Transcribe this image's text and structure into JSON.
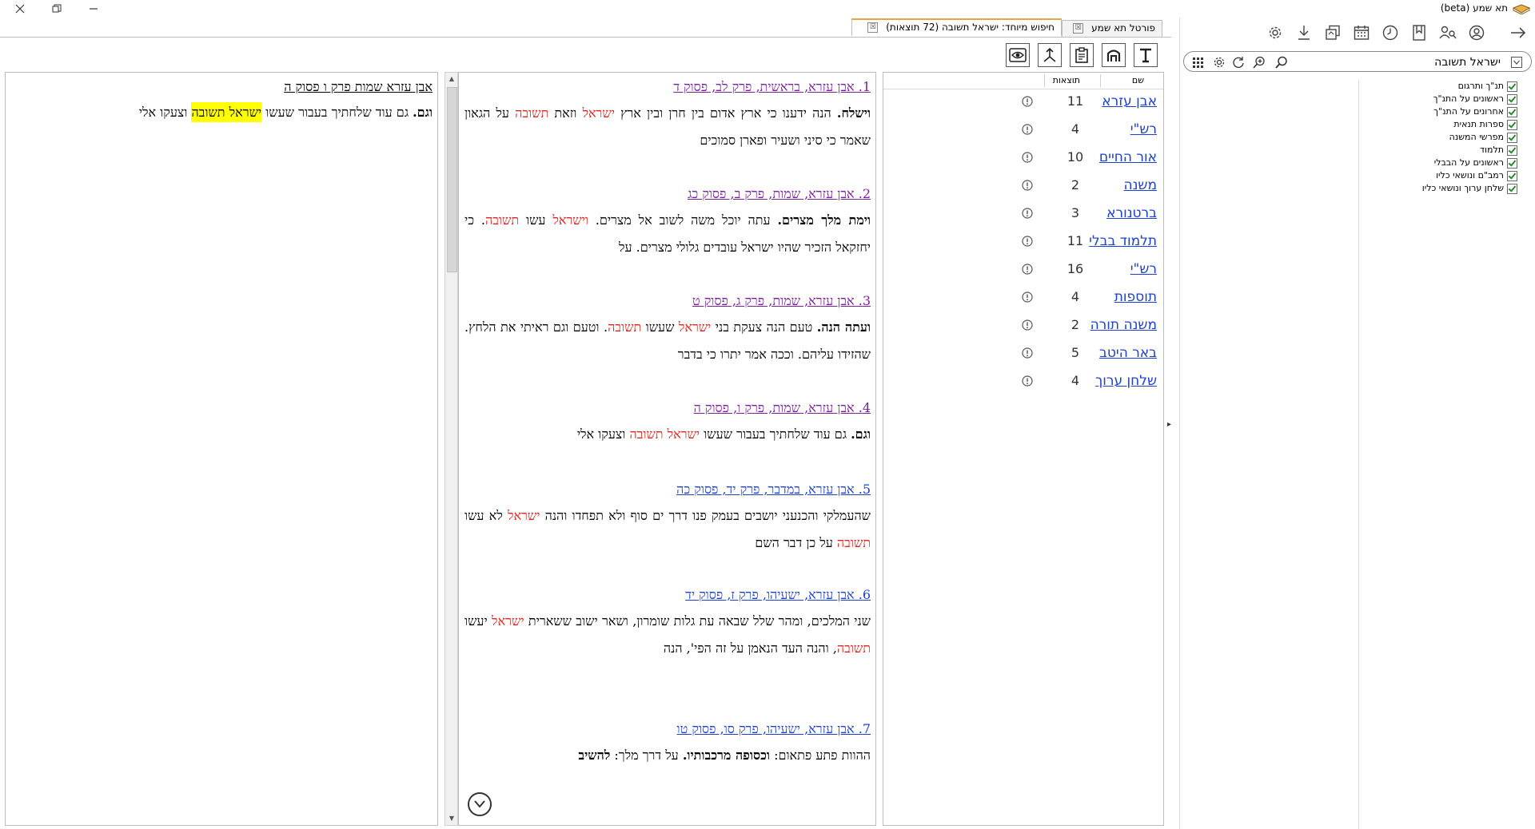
{
  "app": {
    "title": "תא שמע (beta)",
    "window_controls": [
      "close-icon",
      "restore-icon",
      "minimize-icon"
    ]
  },
  "sidebar": {
    "search": {
      "value": "ישראל תשובה",
      "placeholder": ""
    },
    "toolbar_icons": [
      "arrow-right-icon",
      "user-circle-icon",
      "people-search-icon",
      "bookmark-icon",
      "history-icon",
      "calendar-icon",
      "library-icon",
      "download-icon",
      "gear-icon"
    ],
    "search_icons": [
      "search-icon",
      "zoom-in-icon",
      "refresh-icon",
      "settings-gear-icon",
      "grid-icon"
    ],
    "categories": [
      {
        "label": "תנ\"ך ותרגום",
        "checked": true
      },
      {
        "label": "ראשונים על התנ\"ך",
        "checked": true
      },
      {
        "label": "אחרונים על התנ\"ך",
        "checked": true
      },
      {
        "label": "ספרות תנאית",
        "checked": true
      },
      {
        "label": "מפרשי המשנה",
        "checked": true
      },
      {
        "label": "תלמוד",
        "checked": true
      },
      {
        "label": "ראשונים על הבבלי",
        "checked": true
      },
      {
        "label": "רמב\"ם ונושאי כליו",
        "checked": true
      },
      {
        "label": "שלחן ערוך ונושאי כליו",
        "checked": true
      }
    ]
  },
  "tabs": [
    {
      "label": "פורטל תא שמע",
      "close": "☒"
    },
    {
      "label": "חיפוש מיוחד: ישראל תשובה (72 תוצאות)",
      "close": "☒"
    }
  ],
  "content_toolbar": [
    "text-format-icon",
    "structure-icon",
    "clipboard-icon",
    "compare-arrows-icon",
    "eye-icon"
  ],
  "books": {
    "col_name": "שם",
    "col_results": "תוצאות",
    "rows": [
      {
        "name": "אבן עזרא",
        "count": "11"
      },
      {
        "name": "רש\"י",
        "count": "4"
      },
      {
        "name": "אור החיים",
        "count": "10"
      },
      {
        "name": "משנה",
        "count": "2"
      },
      {
        "name": "ברטנורא",
        "count": "3"
      },
      {
        "name": "תלמוד בבלי",
        "count": "11"
      },
      {
        "name": "רש\"י",
        "count": "16"
      },
      {
        "name": "תוספות",
        "count": "4"
      },
      {
        "name": "משנה תורה",
        "count": "2"
      },
      {
        "name": "באר היטב",
        "count": "5"
      },
      {
        "name": "שלחן ערוך",
        "count": "4"
      }
    ]
  },
  "results": [
    {
      "title": "1. אבן עזרא, בראשית, פרק לב, פסוק ד",
      "visited": true,
      "segments": [
        {
          "t": "וישלח.",
          "s": "bold"
        },
        {
          "t": " הנה ידענו כי ארץ אדום בין חרן ובין ארץ ",
          "s": ""
        },
        {
          "t": "ישראל",
          "s": "hl"
        },
        {
          "t": " וזאת ",
          "s": ""
        },
        {
          "t": "תשובה",
          "s": "hl"
        },
        {
          "t": " על הגאון שאמר כי סיני ושעיר ופארן סמוכים",
          "s": ""
        }
      ]
    },
    {
      "title": "2. אבן עזרא, שמות, פרק ב, פסוק כג",
      "visited": true,
      "segments": [
        {
          "t": "וימת מלך מצרים.",
          "s": "bold"
        },
        {
          "t": " עתה יוכל משה לשוב אל מצרים. ",
          "s": ""
        },
        {
          "t": "וישראל",
          "s": "hl"
        },
        {
          "t": " עשו ",
          "s": ""
        },
        {
          "t": "תשובה",
          "s": "hl"
        },
        {
          "t": ". כי יחזקאל הזכיר שהיו ישראל עובדים גלולי מצרים. על",
          "s": ""
        }
      ]
    },
    {
      "title": "3. אבן עזרא, שמות, פרק ג, פסוק ט",
      "visited": true,
      "segments": [
        {
          "t": "ועתה הנה.",
          "s": "bold"
        },
        {
          "t": " טעם הנה צעקת בני ",
          "s": ""
        },
        {
          "t": "ישראל",
          "s": "hl"
        },
        {
          "t": " שעשו ",
          "s": ""
        },
        {
          "t": "תשובה",
          "s": "hl"
        },
        {
          "t": ". וטעם וגם ראיתי את הלחץ. שהזידו עליהם. וככה אמר יתרו כי בדבר",
          "s": ""
        }
      ]
    },
    {
      "title": "4. אבן עזרא, שמות, פרק ו, פסוק ה",
      "visited": true,
      "segments": [
        {
          "t": "וגם.",
          "s": "bold"
        },
        {
          "t": " גם עוד שלחתיך בעבור שעשו ",
          "s": ""
        },
        {
          "t": "ישראל",
          "s": "hl"
        },
        {
          "t": " ",
          "s": ""
        },
        {
          "t": "תשובה",
          "s": "hl"
        },
        {
          "t": " וצעקו אלי",
          "s": ""
        }
      ]
    },
    {
      "title": "5. אבן עזרא, במדבר, פרק יד, פסוק כה",
      "visited": false,
      "segments": [
        {
          "t": "שהעמלקי והכנעני יושבים בעמק פנו דרך ים סוף ולא תפחדו והנה ",
          "s": ""
        },
        {
          "t": "ישראל",
          "s": "hl"
        },
        {
          "t": " לא עשו ",
          "s": ""
        },
        {
          "t": "תשובה",
          "s": "hl"
        },
        {
          "t": " על כן דבר השם",
          "s": ""
        }
      ]
    },
    {
      "title": "6. אבן עזרא, ישעיהו, פרק ז, פסוק יד",
      "visited": false,
      "segments": [
        {
          "t": "שני המלכים, ומהר שלל שבאה עת גלות שומרון, ושאר ישוב ששארית ",
          "s": ""
        },
        {
          "t": "ישראל",
          "s": "hl"
        },
        {
          "t": " יעשו ",
          "s": ""
        },
        {
          "t": "תשובה",
          "s": "hl"
        },
        {
          "t": ", והנה העד הנאמן על זה הפי', הנה",
          "s": ""
        }
      ]
    },
    {
      "title": "7. אבן עזרא, ישעיהו, פרק סו, פסוק טו",
      "visited": false,
      "segments": [
        {
          "t": "ההוות פתע פתאום: ",
          "s": ""
        },
        {
          "t": "וכסופה מרכבותיו.",
          "s": "bold"
        },
        {
          "t": " על דרך מלך: ",
          "s": ""
        },
        {
          "t": "להשיב",
          "s": "bold"
        }
      ]
    }
  ],
  "preview": {
    "title": "אבן עזרא שמות פרק ו פסוק ה",
    "segments": [
      {
        "t": "וגם.",
        "s": "bold"
      },
      {
        "t": " גם עוד שלחתיך בעבור שעשו ",
        "s": ""
      },
      {
        "t": "ישראל תשובה",
        "s": "yellow"
      },
      {
        "t": " וצעקו אלי",
        "s": ""
      }
    ]
  }
}
